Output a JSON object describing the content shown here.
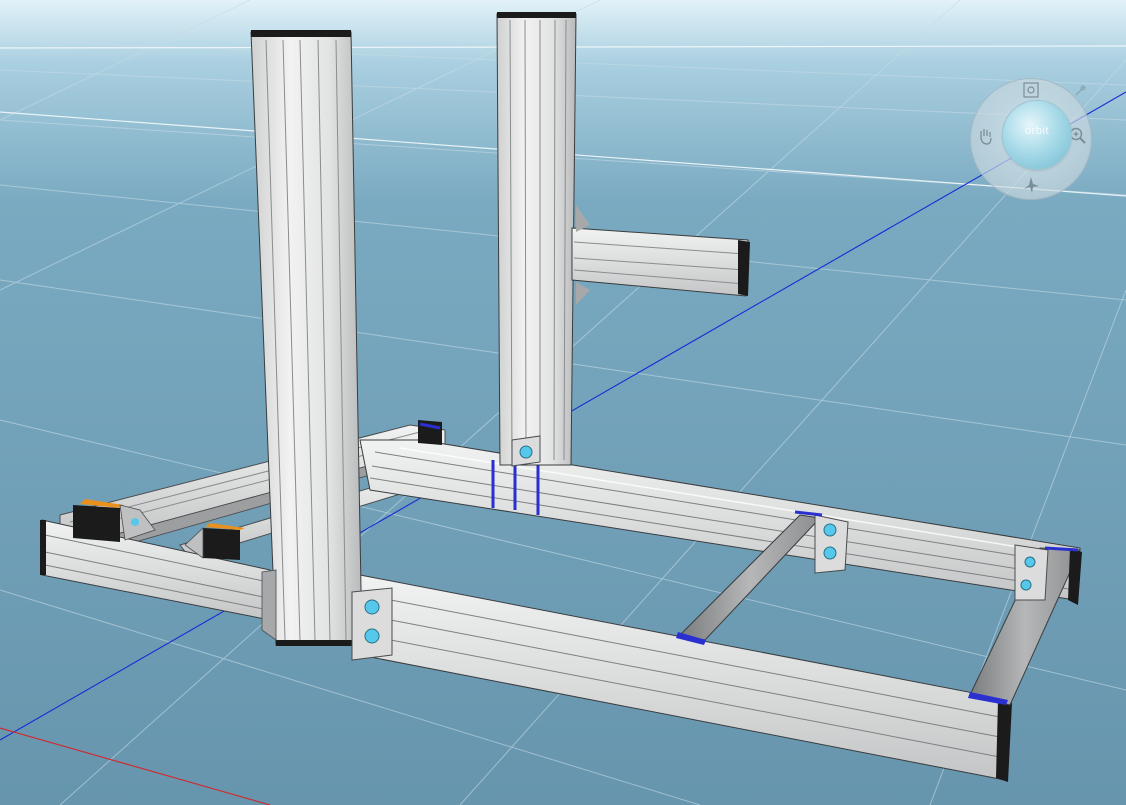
{
  "viewport": {
    "name": "3d-model-viewport",
    "background_color": "#6a9ab3",
    "horizon_color": "#e0f1f8",
    "grid_color": "#bcd4e0",
    "profile_color": "#e9eaea",
    "profile_edge_color": "#3a3c3e",
    "bolt_color": "#56c8ec",
    "x_axis_color": "#d4262a",
    "y_axis_color": "#1a2bd6",
    "cap_orange_color": "#e8911e"
  },
  "navigation_wheel": {
    "center_label": "orbit",
    "icons": [
      "pan-icon",
      "zoom-icon",
      "fly-icon",
      "fit-view-icon",
      "pin-icon"
    ]
  }
}
